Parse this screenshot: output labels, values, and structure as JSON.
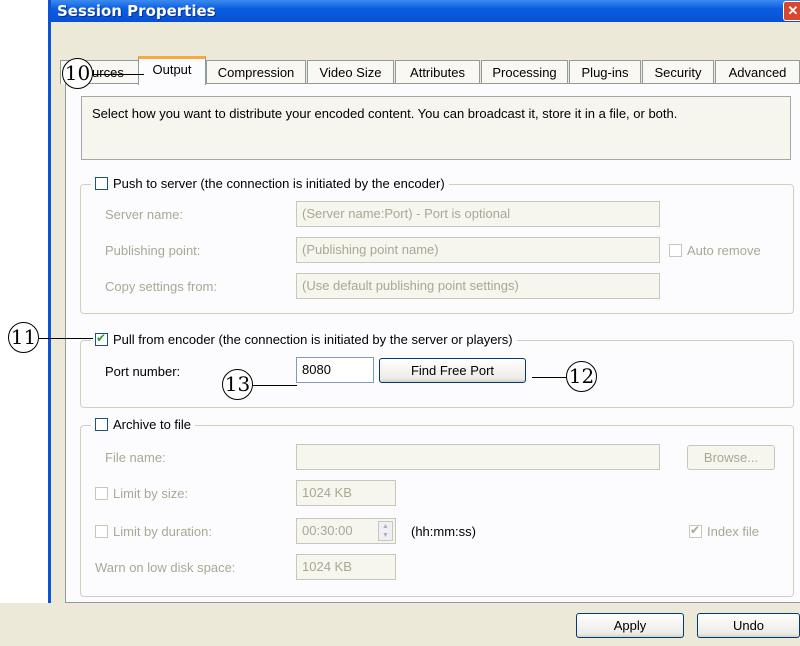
{
  "window": {
    "title": "Session Properties"
  },
  "tabs": [
    {
      "label": "Sources",
      "active": false
    },
    {
      "label": "Output",
      "active": true
    },
    {
      "label": "Compression",
      "active": false
    },
    {
      "label": "Video Size",
      "active": false
    },
    {
      "label": "Attributes",
      "active": false
    },
    {
      "label": "Processing",
      "active": false
    },
    {
      "label": "Plug-ins",
      "active": false
    },
    {
      "label": "Security",
      "active": false
    },
    {
      "label": "Advanced",
      "active": false
    }
  ],
  "description": "Select how you want to distribute your encoded content. You can broadcast it, store it in a file, or both.",
  "push": {
    "label": "Push to server (the connection is initiated by the encoder)",
    "checked": false,
    "server_name_label": "Server name:",
    "server_name_value": "(Server name:Port)  - Port is optional",
    "publishing_point_label": "Publishing point:",
    "publishing_point_value": "(Publishing point name)",
    "auto_remove_label": "Auto remove",
    "copy_settings_label": "Copy settings from:",
    "copy_settings_value": "(Use default publishing point settings)"
  },
  "pull": {
    "label": "Pull from encoder (the connection is initiated by the server or players)",
    "checked": true,
    "port_label": "Port number:",
    "port_value": "8080",
    "find_free_port_label": "Find Free Port"
  },
  "archive": {
    "label": "Archive to file",
    "checked": false,
    "file_name_label": "File name:",
    "file_name_value": "",
    "browse_label": "Browse...",
    "limit_size_label": "Limit by size:",
    "limit_size_value": "1024 KB",
    "limit_duration_label": "Limit by duration:",
    "limit_duration_value": "00:30:00",
    "duration_format": "(hh:mm:ss)",
    "index_file_label": "Index file",
    "index_file_checked": true,
    "warn_label": "Warn on low disk space:",
    "warn_value": "1024 KB"
  },
  "buttons": {
    "apply": "Apply",
    "undo": "Undo"
  },
  "callouts": {
    "c10": "10",
    "c11": "11",
    "c12": "12",
    "c13": "13"
  }
}
